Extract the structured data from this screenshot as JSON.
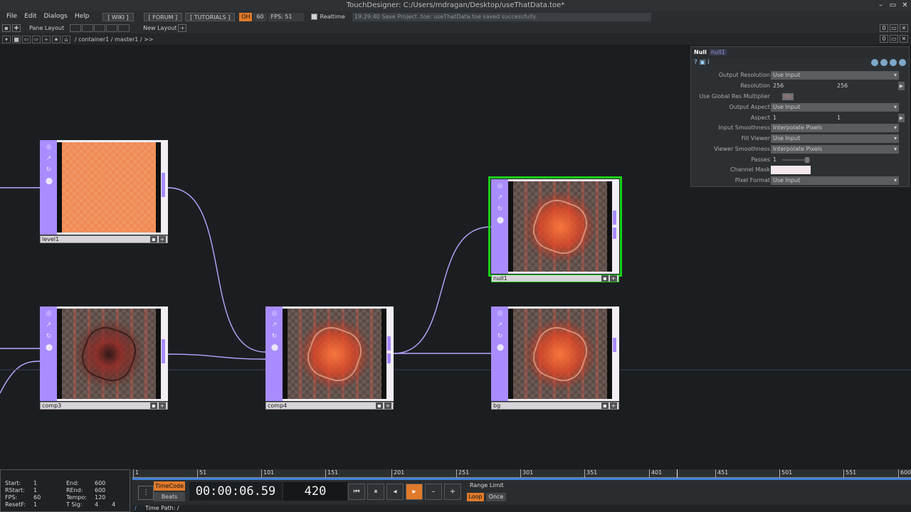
{
  "window": {
    "title": "TouchDesigner: C:/Users/mdragan/Desktop/useThatData.toe*",
    "controls": [
      "–",
      "▭",
      "✕"
    ]
  },
  "menubar": {
    "items": [
      "File",
      "Edit",
      "Dialogs",
      "Help"
    ],
    "links": [
      "[ WIKI ]",
      "[ FORUM ]",
      "[ TUTORIALS ]"
    ],
    "op_label": "OH",
    "fps_target": "60",
    "fps_label": "FPS: 51",
    "realtime_label": "Realtime",
    "status_message": "19:29:40 Save Project .toe: useThatData.toe saved successfully."
  },
  "panebar": {
    "pane_layout_label": "Pane Layout",
    "new_layout_label": "New Layout",
    "add_label": "+"
  },
  "pathbar": {
    "path": "/ container1 / master1 / >>"
  },
  "nodes": {
    "level1": {
      "name": "level1"
    },
    "comp3": {
      "name": "comp3"
    },
    "comp4": {
      "name": "comp4"
    },
    "null1": {
      "name": "null1"
    },
    "bg": {
      "name": "bg"
    }
  },
  "params": {
    "op_type": "Null",
    "op_name": "null1",
    "rows": [
      {
        "label": "Output Resolution",
        "value": "Use Input"
      },
      {
        "label": "Resolution",
        "value1": "256",
        "value2": "256"
      },
      {
        "label": "Use Global Res Multiplier",
        "value": "On"
      },
      {
        "label": "Output Aspect",
        "value": "Use Input"
      },
      {
        "label": "Aspect",
        "value1": "1",
        "value2": "1"
      },
      {
        "label": "Input Smoothness",
        "value": "Interpolate Pixels"
      },
      {
        "label": "Fill Viewer",
        "value": "Use Input"
      },
      {
        "label": "Viewer Smoothness",
        "value": "Interpolate Pixels"
      },
      {
        "label": "Passes",
        "value": "1"
      },
      {
        "label": "Channel Mask",
        "value": ""
      },
      {
        "label": "Pixel Format",
        "value": "Use Input"
      }
    ]
  },
  "stats": {
    "start_label": "Start:",
    "start": "1",
    "end_label": "End:",
    "end": "600",
    "rstart_label": "RStart:",
    "rstart": "1",
    "rend_label": "REnd:",
    "rend": "600",
    "fps_label": "FPS:",
    "fps": "60",
    "tempo_label": "Tempo:",
    "tempo": "120",
    "resetf_label": "ResetF:",
    "resetf": "1",
    "tsig_label": "T Sig:",
    "tsig1": "4",
    "tsig2": "4"
  },
  "ruler": {
    "ticks": [
      "1",
      "51",
      "101",
      "151",
      "201",
      "251",
      "301",
      "351",
      "401",
      "451",
      "501",
      "551",
      "600"
    ]
  },
  "transport": {
    "timecode_label": "TimeCode",
    "beats_label": "Beats",
    "timecode": "00:00:06.59",
    "frame": "420",
    "buttons": [
      "⏮",
      "⏸",
      "◂",
      "▸",
      "–",
      "+"
    ],
    "range_limit_label": "Range Limit",
    "loop_label": "Loop",
    "once_label": "Once"
  },
  "timepath": {
    "label": "Time Path: /"
  },
  "colors": {
    "accent_orange": "#e07a2a",
    "node_purple": "#a98cff",
    "selection_green": "#19d019",
    "wire": "#b7a7ff"
  }
}
